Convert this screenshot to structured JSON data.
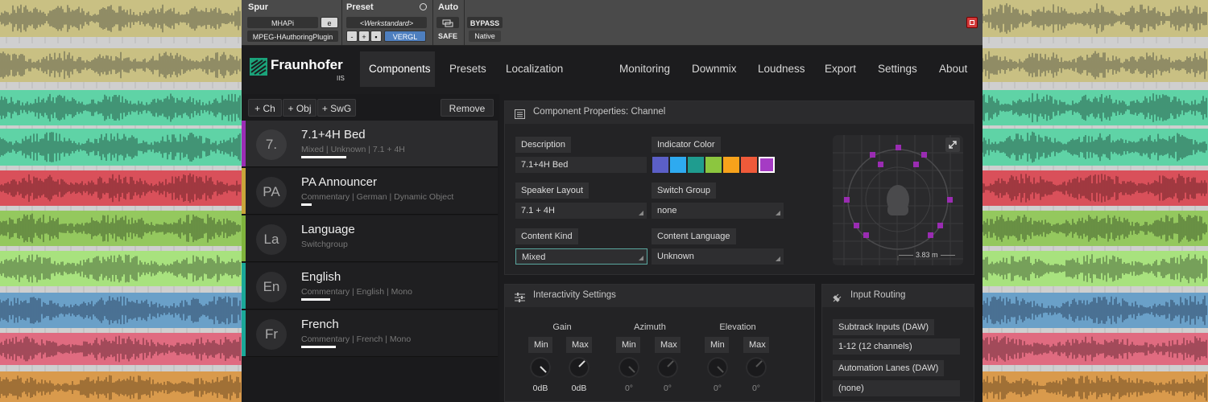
{
  "top_bar": {
    "spur_header": "Spur",
    "preset_header": "Preset",
    "auto_header": "Auto",
    "track_name": "MHAPi",
    "track_mode": "e",
    "plugin_name": "MPEG-HAuthoringPlugin",
    "preset_value": "<Werkstandard>",
    "preset_minus": "-",
    "preset_plus": "+",
    "compare": "VERGL",
    "safe": "SAFE",
    "bypass": "BYPASS",
    "native": "Native"
  },
  "brand": {
    "name": "Fraunhofer",
    "sub": "IIS"
  },
  "nav": {
    "components": "Components",
    "presets": "Presets",
    "localization": "Localization",
    "monitoring": "Monitoring",
    "downmix": "Downmix",
    "loudness": "Loudness",
    "export": "Export",
    "settings": "Settings",
    "about": "About"
  },
  "toolbar": {
    "add_ch": "+ Ch",
    "add_obj": "+ Obj",
    "add_swg": "+ SwG",
    "remove": "Remove"
  },
  "components": [
    {
      "abbr": "7.",
      "title": "7.1+4H Bed",
      "subtitle": "Mixed | Unknown | 7.1 + 4H",
      "color": "#9b2db5",
      "level": 0.85
    },
    {
      "abbr": "PA",
      "title": "PA Announcer",
      "subtitle": "Commentary | German | Dynamic Object",
      "color": "#c9a53a",
      "level": 0.2
    },
    {
      "abbr": "La",
      "title": "Language",
      "subtitle": "Switchgroup",
      "color": "#7fb33c",
      "level": 0
    },
    {
      "abbr": "En",
      "title": "English",
      "subtitle": "Commentary | English | Mono",
      "color": "#1aa898",
      "level": 0.55
    },
    {
      "abbr": "Fr",
      "title": "French",
      "subtitle": "Commentary | French | Mono",
      "color": "#1aa898",
      "level": 0.65
    }
  ],
  "props": {
    "header": "Component Properties: Channel",
    "description_label": "Description",
    "description_value": "7.1+4H Bed",
    "indicator_label": "Indicator Color",
    "swatches": [
      "#5b5fc7",
      "#2eaaf0",
      "#1f9c8f",
      "#8cc63f",
      "#f7a21b",
      "#ef5a3a",
      "#a53bc4"
    ],
    "speaker_layout_label": "Speaker Layout",
    "speaker_layout_value": "7.1 + 4H",
    "switch_group_label": "Switch Group",
    "switch_group_value": "none",
    "content_kind_label": "Content Kind",
    "content_kind_value": "Mixed",
    "content_language_label": "Content Language",
    "content_language_value": "Unknown",
    "distance": "3.83 m"
  },
  "interactivity": {
    "header": "Interactivity Settings",
    "gain_label": "Gain",
    "azimuth_label": "Azimuth",
    "elevation_label": "Elevation",
    "min_label": "Min",
    "max_label": "Max",
    "gain_min": "0dB",
    "gain_max": "0dB",
    "az_min": "0°",
    "az_max": "0°",
    "el_min": "0°",
    "el_max": "0°"
  },
  "routing": {
    "header": "Input Routing",
    "subtrack_label": "Subtrack Inputs (DAW)",
    "subtrack_value": "1-12 (12 channels)",
    "automation_label": "Automation Lanes (DAW)",
    "automation_value": "(none)"
  }
}
